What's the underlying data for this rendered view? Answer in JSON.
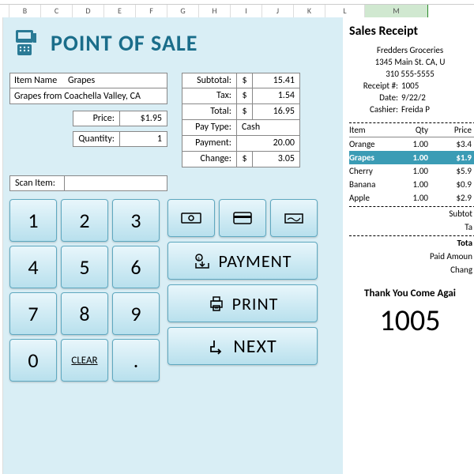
{
  "columns": [
    "B",
    "C",
    "D",
    "E",
    "F",
    "G",
    "H",
    "I",
    "J",
    "K",
    "L",
    "M"
  ],
  "title": "POINT OF SALE",
  "item": {
    "name_label": "Item Name",
    "name": "Grapes",
    "desc": "Grapes from Coachella Valley, CA",
    "price_label": "Price:",
    "price": "$1.95",
    "qty_label": "Quantity:",
    "qty": "1"
  },
  "totals": {
    "subtotal_label": "Subtotal:",
    "subtotal": "15.41",
    "tax_label": "Tax:",
    "tax": "1.54",
    "total_label": "Total:",
    "total": "16.95",
    "paytype_label": "Pay Type:",
    "paytype": "Cash",
    "payment_label": "Payment:",
    "payment": "20.00",
    "change_label": "Change:",
    "change": "3.05",
    "currency": "$"
  },
  "scan_label": "Scan Item:",
  "scan_value": "",
  "keys": [
    "1",
    "2",
    "3",
    "4",
    "5",
    "6",
    "7",
    "8",
    "9",
    "0",
    "CLEAR",
    "."
  ],
  "actions": {
    "payment": "PAYMENT",
    "print": "PRINT",
    "next": "NEXT"
  },
  "receipt": {
    "title": "Sales Receipt",
    "store": "Fredders Groceries",
    "address": "1345 Main St. CA, U",
    "phone": "310 555-5555",
    "receipt_no_label": "Receipt #:",
    "receipt_no": "1005",
    "date_label": "Date:",
    "date": "9/22/2",
    "cashier_label": "Cashier:",
    "cashier": "Freida P",
    "headers": [
      "Item",
      "Qty",
      "Price"
    ],
    "items": [
      {
        "name": "Orange",
        "qty": "1.00",
        "price": "$3.4"
      },
      {
        "name": "Grapes",
        "qty": "1.00",
        "price": "$1.9",
        "highlight": true
      },
      {
        "name": "Cherry",
        "qty": "1.00",
        "price": "$5.9"
      },
      {
        "name": "Banana",
        "qty": "1.00",
        "price": "$0.9"
      },
      {
        "name": "Apple",
        "qty": "1.00",
        "price": "$2.9"
      }
    ],
    "subtotal_label": "Subtot",
    "tax_label": "Ta",
    "total_label": "Tota",
    "paid_label": "Paid Amoun",
    "change_label": "Chang",
    "thank": "Thank You Come Agai",
    "big": "1005"
  }
}
